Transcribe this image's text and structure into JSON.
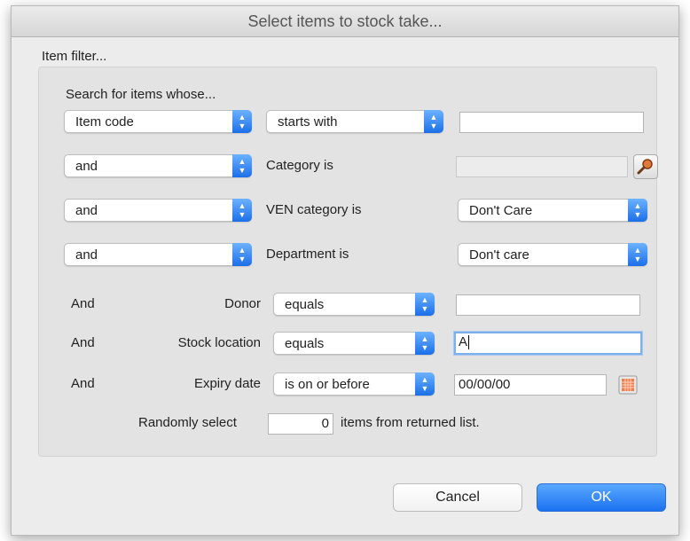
{
  "window": {
    "title": "Select items to stock take..."
  },
  "filter": {
    "group_label": "Item filter...",
    "search_label": "Search for items whose...",
    "row1": {
      "field": "Item code",
      "operator": "starts with",
      "value": ""
    },
    "row2": {
      "conj": "and",
      "label": "Category is",
      "value": ""
    },
    "row3": {
      "conj": "and",
      "label": "VEN category is",
      "value": "Don't Care"
    },
    "row4": {
      "conj": "and",
      "label": "Department is",
      "value": "Don't care"
    },
    "donor": {
      "conj": "And",
      "label": "Donor",
      "operator": "equals",
      "value": ""
    },
    "location": {
      "conj": "And",
      "label": "Stock location",
      "operator": "equals",
      "value": "A"
    },
    "expiry": {
      "conj": "And",
      "label": "Expiry date",
      "operator": "is on or before",
      "value": "00/00/00"
    },
    "random": {
      "prefix": "Randomly select",
      "count": "0",
      "suffix": "items from returned list."
    }
  },
  "buttons": {
    "cancel": "Cancel",
    "ok": "OK"
  },
  "icons": {
    "category_lookup": "magnifier-icon",
    "expiry_picker": "calendar-icon"
  },
  "colors": {
    "accent": "#1b72f0"
  }
}
